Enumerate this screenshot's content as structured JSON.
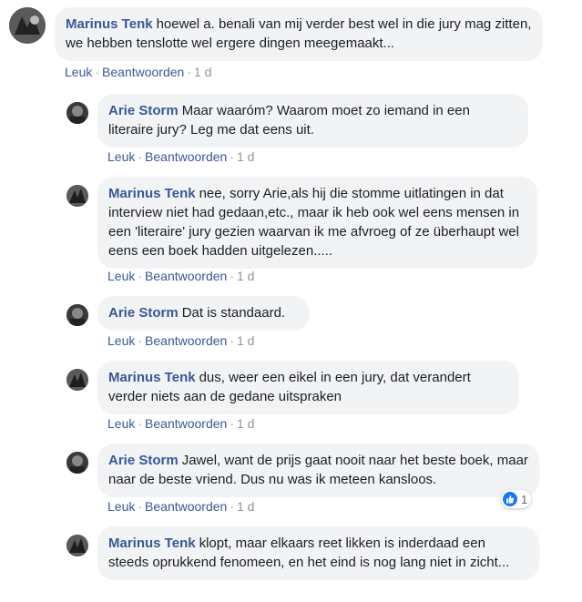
{
  "actions": {
    "like": "Leuk",
    "reply": "Beantwoorden",
    "separator": "·"
  },
  "comments": [
    {
      "author": "Marinus Tenk",
      "text": "hoewel a. benali van mij verder best wel in die jury mag zitten, we hebben tenslotte wel ergere dingen meegemaakt...",
      "time": "1 d"
    },
    {
      "author": "Arie Storm",
      "text": "Maar waaróm? Waarom moet zo iemand in een literaire jury? Leg me dat eens uit.",
      "time": "1 d"
    },
    {
      "author": "Marinus Tenk",
      "text": "nee, sorry Arie,als hij die stomme uitlatingen in dat interview niet had gedaan,etc., maar ik heb ook wel eens mensen in een 'literaire' jury gezien waarvan ik me afvroeg of ze überhaupt wel eens een boek hadden uitgelezen.....",
      "time": "1 d"
    },
    {
      "author": "Arie Storm",
      "text": "Dat is standaard.",
      "time": "1 d"
    },
    {
      "author": "Marinus Tenk",
      "text": "dus, weer een eikel in een jury, dat verandert verder niets aan de gedane uitspraken",
      "time": "1 d"
    },
    {
      "author": "Arie Storm",
      "text": "Jawel, want de prijs gaat nooit naar het beste boek, maar naar de beste vriend. Dus nu was ik meteen kansloos.",
      "time": "1 d",
      "reactions": {
        "icon": "like-icon",
        "count": "1"
      }
    },
    {
      "author": "Marinus Tenk",
      "text": "klopt, maar elkaars reet likken is inderdaad een steeds oprukkend fenomeen, en het eind is nog lang niet in zicht...",
      "time": ""
    }
  ],
  "colors": {
    "author": "#385898",
    "bubble": "#f2f3f5",
    "meta": "#606770",
    "like": "#1877f2"
  }
}
